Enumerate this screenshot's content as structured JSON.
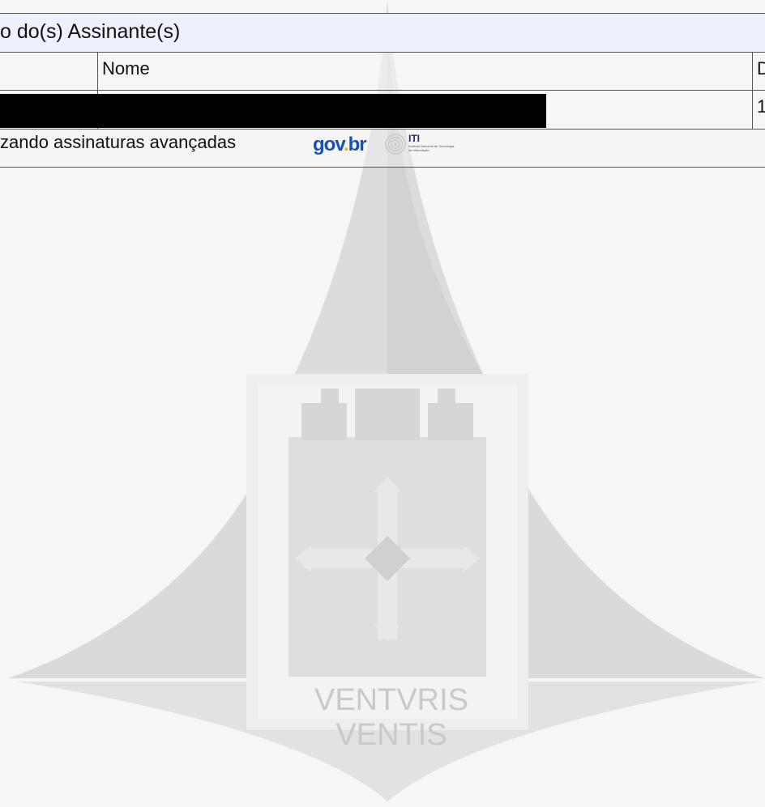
{
  "signatures": {
    "title": "o do(s) Assinante(s)",
    "columns": {
      "name": "Nome",
      "date_partial": "D"
    },
    "rows": [
      {
        "name": "",
        "date_partial": "1"
      }
    ],
    "footer": {
      "text": "zando assinaturas avançadas",
      "logos": {
        "govbr": [
          "go",
          "v",
          ".",
          "br"
        ],
        "iti": "ITI",
        "iti_subtitle": "Instituto Nacional de Tecnologia da Informação"
      }
    }
  },
  "watermark": {
    "motto": "VENTVRIS VENTIS"
  }
}
